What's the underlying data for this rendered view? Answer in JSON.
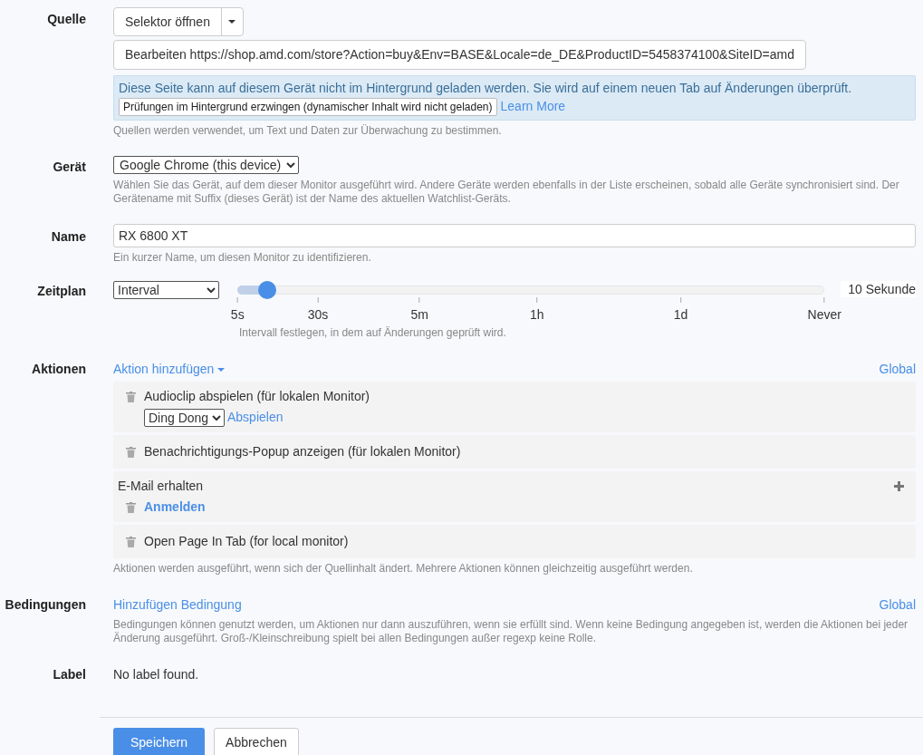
{
  "source": {
    "label": "Quelle",
    "selector_button": "Selektor öffnen",
    "url_field": "Bearbeiten https://shop.amd.com/store?Action=buy&Env=BASE&Locale=de_DE&ProductID=5458374100&SiteID=amd",
    "notice": "Diese Seite kann auf diesem Gerät nicht im Hintergrund geladen werden. Sie wird auf einem neuen Tab auf Änderungen überprüft.",
    "force_button": "Prüfungen im Hintergrund erzwingen (dynamischer Inhalt wird nicht geladen)",
    "learn_more": "Learn More",
    "help": "Quellen werden verwendet, um Text und Daten zur Überwachung zu bestimmen."
  },
  "device": {
    "label": "Gerät",
    "value": "Google Chrome (this device)",
    "help": "Wählen Sie das Gerät, auf dem dieser Monitor ausgeführt wird. Andere Geräte werden ebenfalls in der Liste erscheinen, sobald alle Geräte synchronisiert sind. Der Gerätename mit Suffix (dieses Gerät) ist der Name des aktuellen Watchlist-Geräts."
  },
  "name": {
    "label": "Name",
    "value": "RX 6800 XT",
    "help": "Ein kurzer Name, um diesen Monitor zu identifizieren."
  },
  "schedule": {
    "label": "Zeitplan",
    "mode": "Interval",
    "level": 0.05,
    "ticks": [
      "5s",
      "30s",
      "5m",
      "1h",
      "1d",
      "Never"
    ],
    "reading": "10 Sekunde",
    "help": "Intervall festlegen, in dem auf Änderungen geprüft wird."
  },
  "actions": {
    "label": "Aktionen",
    "add": "Aktion hinzufügen",
    "global": "Global",
    "items": [
      {
        "kind": "audio",
        "text": "Audioclip abspielen (für lokalen Monitor)",
        "sound": "Ding Dong",
        "play": "Abspielen"
      },
      {
        "kind": "simple",
        "text": "Benachrichtigungs-Popup anzeigen (für lokalen Monitor)"
      },
      {
        "kind": "email",
        "text": "E-Mail erhalten",
        "link": "Anmelden"
      },
      {
        "kind": "simple",
        "text": "Open Page In Tab (for local monitor)"
      }
    ],
    "help": "Aktionen werden ausgeführt, wenn sich der Quellinhalt ändert. Mehrere Aktionen können gleichzeitig ausgeführt werden."
  },
  "conditions": {
    "label": "Bedingungen",
    "add": "Hinzufügen Bedingung",
    "global": "Global",
    "help": "Bedingungen können genutzt werden, um Aktionen nur dann auszuführen, wenn sie erfüllt sind. Wenn keine Bedingung angegeben ist, werden die Aktionen bei jeder Änderung ausgeführt. Groß-/Kleinschreibung spielt bei allen Bedingungen außer regexp keine Rolle."
  },
  "label_row": {
    "label": "Label",
    "value": "No label found."
  },
  "buttons": {
    "save": "Speichern",
    "cancel": "Abbrechen"
  }
}
